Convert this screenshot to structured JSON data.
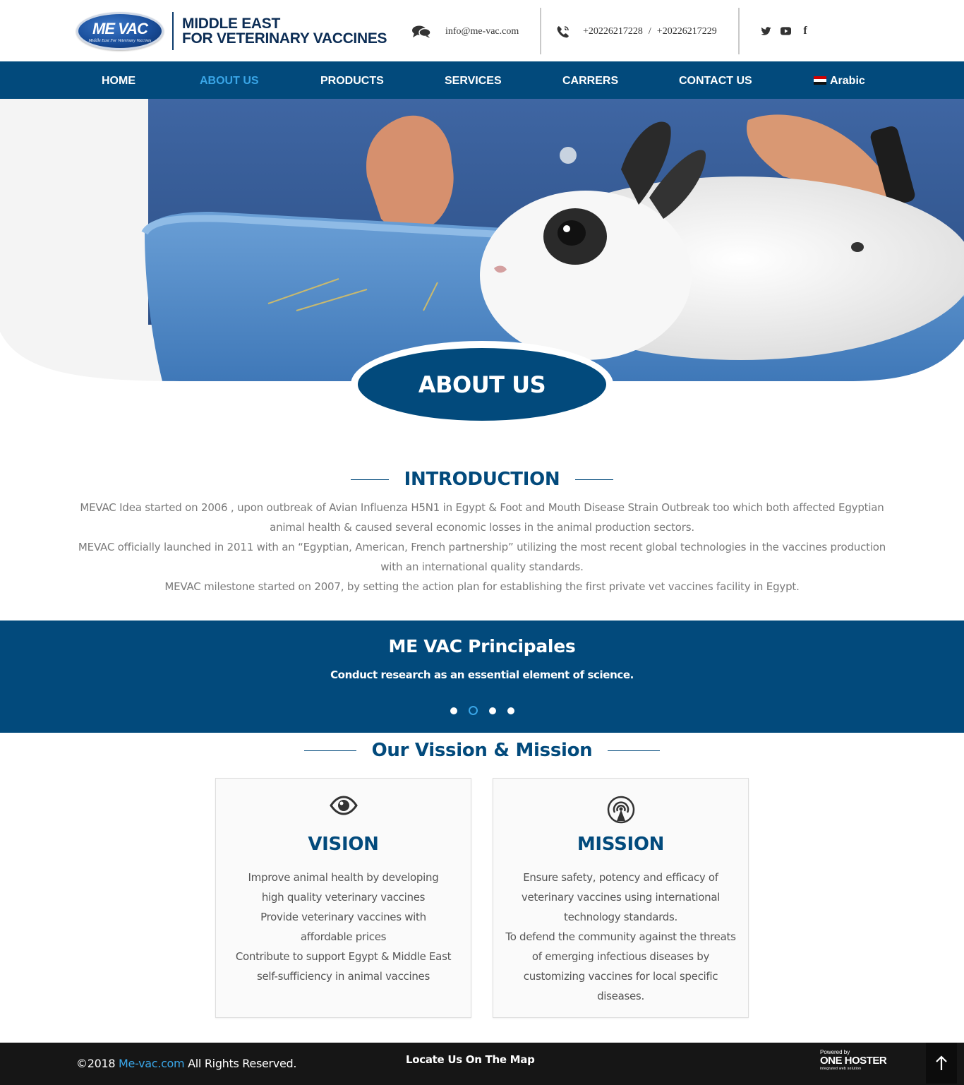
{
  "header": {
    "logo": {
      "text": "ME VAC",
      "subtitle": "Middle East For Veterinary Vaccines",
      "icon": "mevac-logo-icon"
    },
    "brand_line1": "MIDDLE EAST",
    "brand_line2": "FOR VETERINARY VACCINES",
    "email": "info@me-vac.com",
    "email_icon": "chat-bubbles-icon",
    "phone1": "+20226217228",
    "phone_separator": "/",
    "phone2": "+20226217229",
    "phone_icon": "phone-icon",
    "socials": [
      {
        "icon": "twitter-icon",
        "glyph": "🐦"
      },
      {
        "icon": "youtube-icon",
        "glyph": "▶"
      },
      {
        "icon": "facebook-icon",
        "glyph": "f"
      }
    ]
  },
  "nav": {
    "items": [
      {
        "label": "HOME",
        "active": false
      },
      {
        "label": "ABOUT US",
        "active": true
      },
      {
        "label": "PRODUCTS",
        "active": false
      },
      {
        "label": "SERVICES",
        "active": false
      },
      {
        "label": "CARRERS",
        "active": false
      },
      {
        "label": "CONTACT US",
        "active": false
      },
      {
        "label": "Arabic",
        "active": false,
        "icon": "egypt-flag-icon"
      }
    ],
    "active_color": "#3aa6e8",
    "bg_color": "#024a7c"
  },
  "hero": {
    "badge_title": "ABOUT US"
  },
  "intro": {
    "title": "INTRODUCTION",
    "paragraphs": [
      "MEVAC Idea started on 2006 , upon outbreak of Avian Influenza H5N1 in Egypt & Foot and Mouth Disease Strain Outbreak too which both affected Egyptian animal health & caused several economic losses in the animal production sectors.",
      "MEVAC officially launched in 2011 with an “Egyptian, American, French partnership” utilizing the most recent global technologies in the vaccines production with an international quality standards.",
      "MEVAC milestone started on 2007, by setting the action plan for establishing the first private vet vaccines facility in Egypt."
    ]
  },
  "principles": {
    "title": "ME VAC Principales",
    "text": "Conduct research as an essential element of science.",
    "slides": 4,
    "active_slide": 2
  },
  "vision_mission": {
    "title": "Our Vission & Mission",
    "vision": {
      "icon": "eye-icon",
      "title": "VISION",
      "lines": [
        "Improve animal health by developing high quality veterinary vaccines",
        "Provide veterinary vaccines with affordable prices",
        "Contribute to support Egypt & Middle East self-sufficiency in animal vaccines"
      ]
    },
    "mission": {
      "icon": "broadcast-icon",
      "title": "MISSION",
      "lines": [
        "Ensure safety, potency and efficacy of veterinary vaccines using international technology standards.",
        "To defend the community against the threats of emerging infectious diseases by customizing vaccines for local specific diseases."
      ]
    }
  },
  "footer": {
    "copyright_prefix": "©2018 ",
    "copyright_link": "Me-vac.com",
    "copyright_suffix": " All Rights Reserved.",
    "locate": "Locate Us On The Map",
    "powered_by": "Powered by",
    "hoster_name": "ONE HOSTER",
    "hoster_tagline": "integrated web solution",
    "to_top_icon": "arrow-up-icon"
  }
}
